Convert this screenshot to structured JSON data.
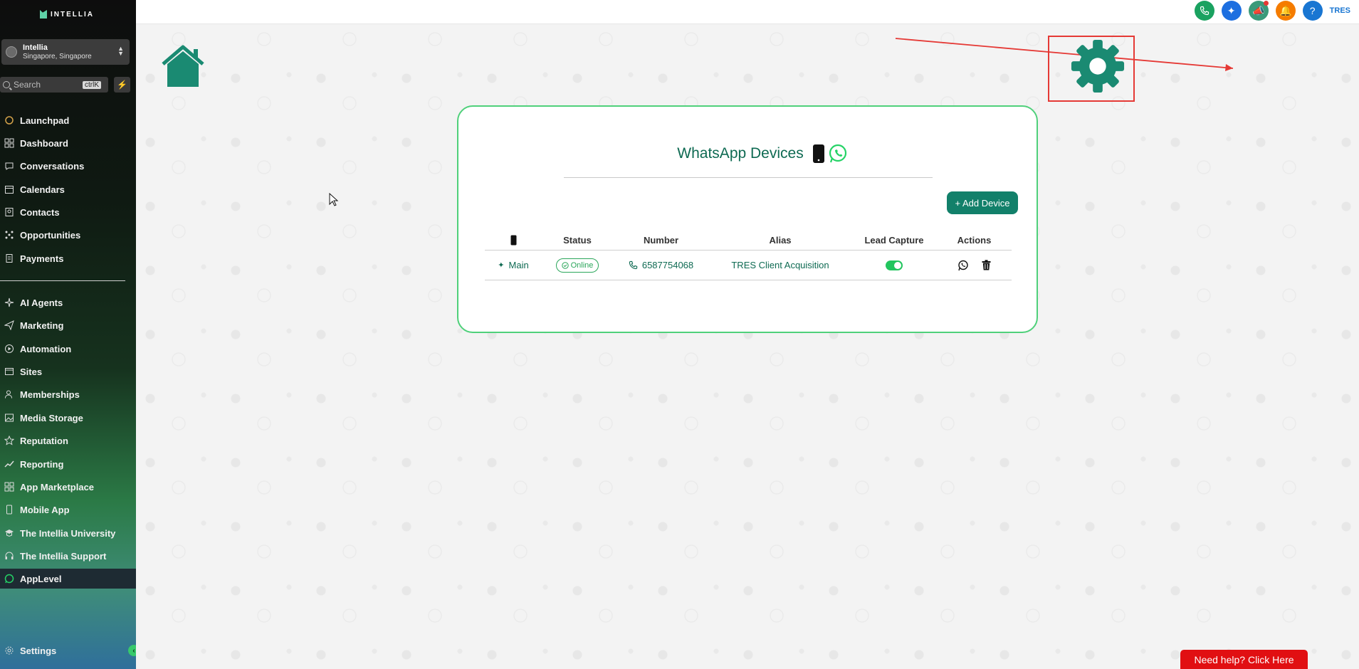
{
  "brand": {
    "name": "INTELLIA"
  },
  "location": {
    "name": "Intellia",
    "sub": "Singapore, Singapore"
  },
  "search": {
    "placeholder": "Search",
    "shortcut": "ctrlK"
  },
  "nav": {
    "launchpad": "Launchpad",
    "dashboard": "Dashboard",
    "conversations": "Conversations",
    "calendars": "Calendars",
    "contacts": "Contacts",
    "opportunities": "Opportunities",
    "payments": "Payments",
    "ai_agents": "AI Agents",
    "marketing": "Marketing",
    "automation": "Automation",
    "sites": "Sites",
    "memberships": "Memberships",
    "media_storage": "Media Storage",
    "reputation": "Reputation",
    "reporting": "Reporting",
    "app_marketplace": "App Marketplace",
    "mobile_app": "Mobile App",
    "university": "The Intellia University",
    "support": "The Intellia Support",
    "applevel": "AppLevel",
    "settings": "Settings"
  },
  "topbar": {
    "user": "TRES",
    "colors": {
      "phone": "#1aa260",
      "spark": "#1d6fe0",
      "announce": "#3a9a7a",
      "bell": "#f57c00",
      "help": "#1976d2"
    }
  },
  "card": {
    "title": "WhatsApp Devices",
    "add_button": "+ Add Device",
    "columns": {
      "status": "Status",
      "number": "Number",
      "alias": "Alias",
      "lead_capture": "Lead Capture",
      "actions": "Actions"
    },
    "rows": [
      {
        "name": "Main",
        "status": "Online",
        "number": "6587754068",
        "alias": "TRES Client Acquisition",
        "lead_capture": true
      }
    ]
  },
  "help_button": "Need help? Click Here",
  "accent": "#12806a"
}
